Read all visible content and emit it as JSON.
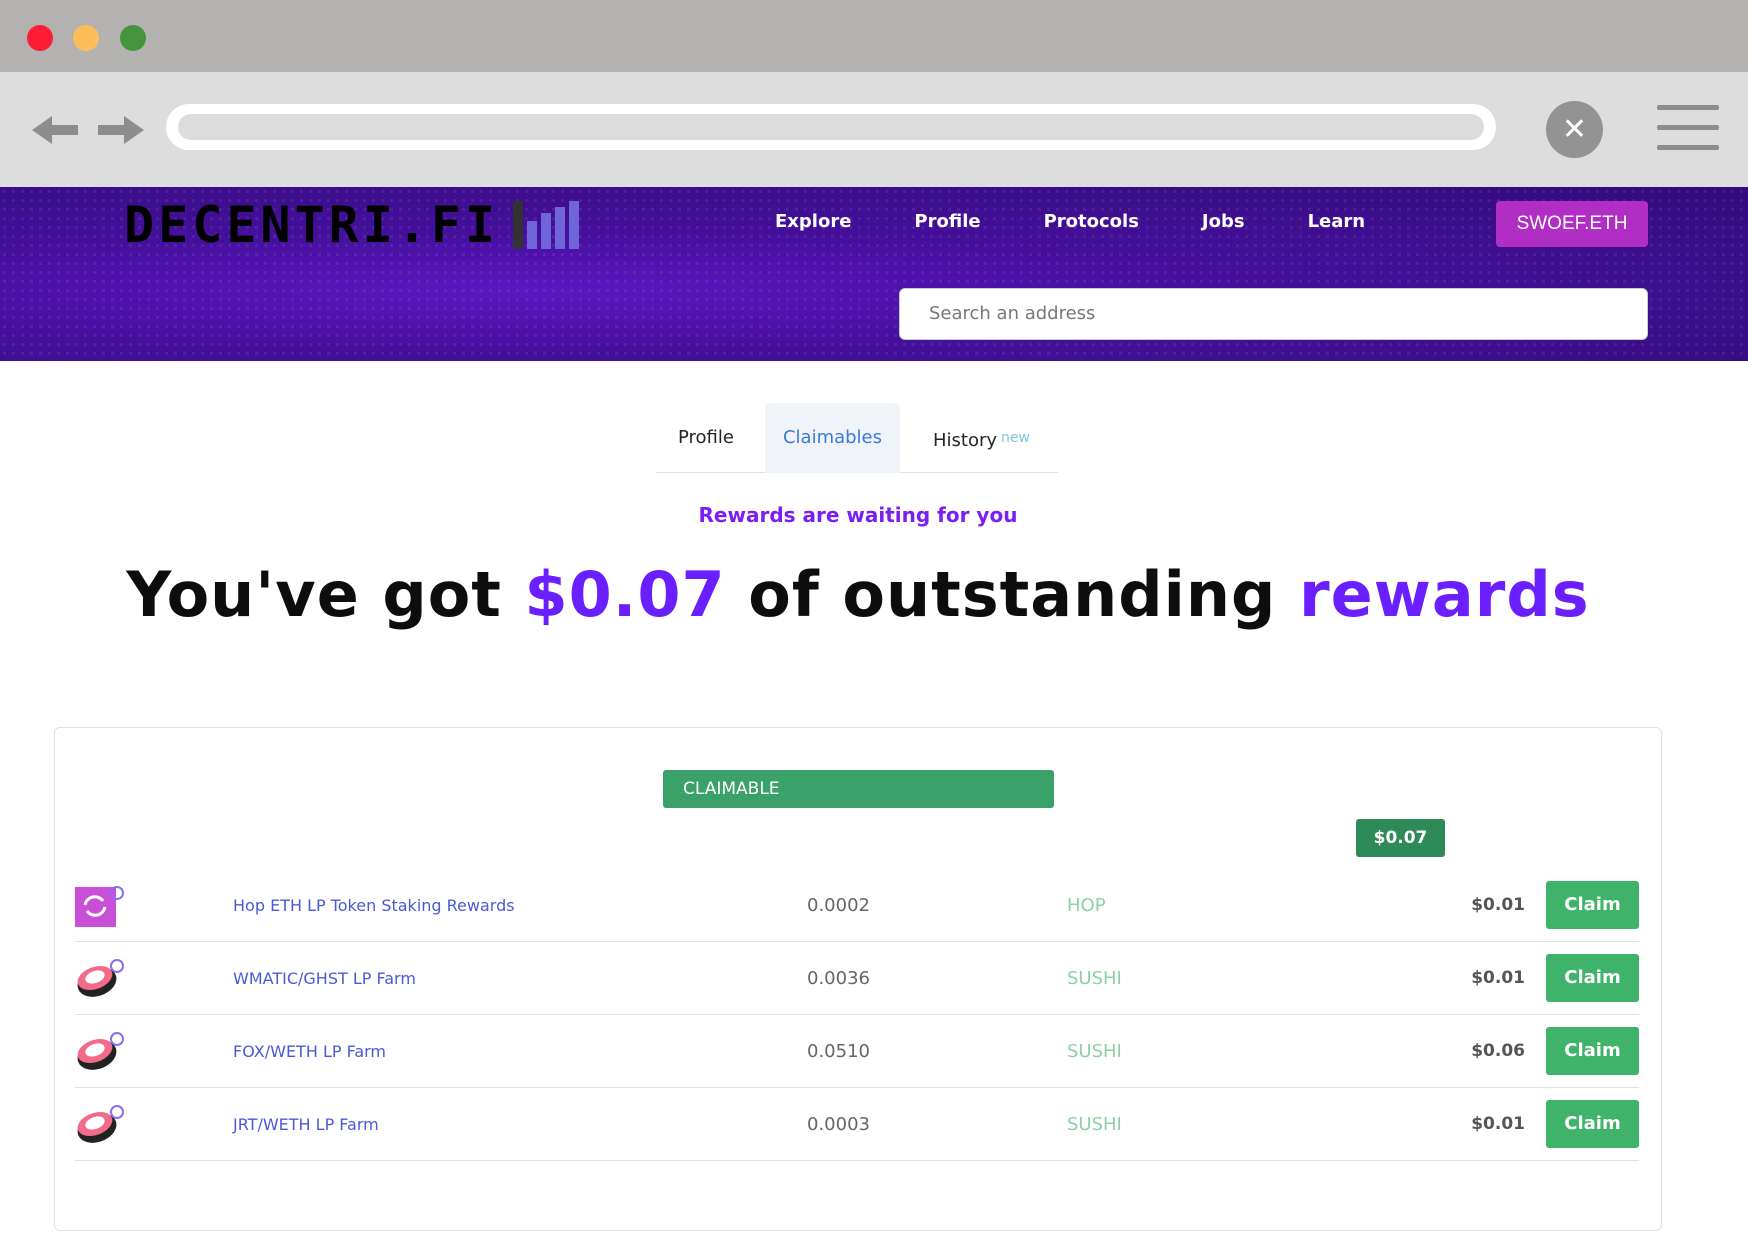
{
  "browser": {
    "close_icon": "x-icon"
  },
  "header": {
    "logo_text": "DECENTRI.FI",
    "nav": [
      "Explore",
      "Profile",
      "Protocols",
      "Jobs",
      "Learn"
    ],
    "wallet": "SWOEF.ETH",
    "search_placeholder": "Search an address"
  },
  "tabs": {
    "profile": "Profile",
    "claimables": "Claimables",
    "history": "History",
    "history_badge": "new"
  },
  "subhead": "Rewards are waiting for you",
  "hero": {
    "prefix": "You've got ",
    "amount": "$0.07",
    "middle": " of outstanding ",
    "suffix": "rewards"
  },
  "card": {
    "section_label": "CLAIMABLE",
    "total": "$0.07",
    "claim_label": "Claim",
    "rows": [
      {
        "icon": "hop-icon",
        "name": "Hop ETH LP Token Staking Rewards",
        "amount": "0.0002",
        "token": "HOP",
        "value": "$0.01"
      },
      {
        "icon": "sushi-icon",
        "name": "WMATIC/GHST LP Farm",
        "amount": "0.0036",
        "token": "SUSHI",
        "value": "$0.01"
      },
      {
        "icon": "sushi-icon",
        "name": "FOX/WETH LP Farm",
        "amount": "0.0510",
        "token": "SUSHI",
        "value": "$0.06"
      },
      {
        "icon": "sushi-icon",
        "name": "JRT/WETH LP Farm",
        "amount": "0.0003",
        "token": "SUSHI",
        "value": "$0.01"
      }
    ]
  },
  "colors": {
    "accent": "#6a1fff",
    "header_bg": "#45109c",
    "claim_green": "#3fb36a",
    "wallet_btn": "#b02ec4"
  }
}
